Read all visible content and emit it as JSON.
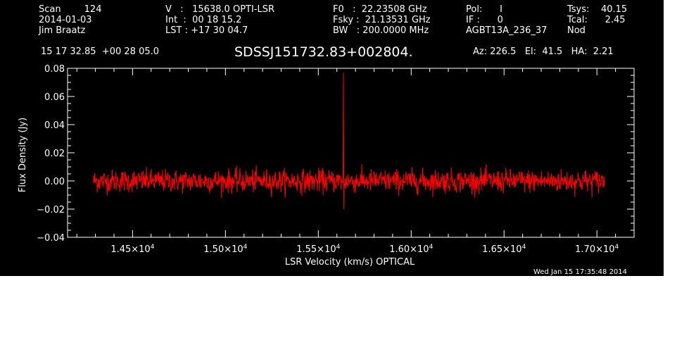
{
  "header": {
    "col1": {
      "scan": "Scan        124",
      "date": "2014-01-03",
      "observer": "Jim Braatz",
      "coords": "15 17 32.85  +00 28 05.0"
    },
    "col2": {
      "velocity": "V   :   15638.0 OPTI-LSR",
      "int": "Int  :  00 18 15.2",
      "lst": "LST : +17 30 04.7"
    },
    "col3": {
      "f0": "F0   :  22.23508 GHz",
      "fsky": "Fsky :  21.13531 GHz",
      "bw": "BW   : 200.0000 MHz"
    },
    "col4": {
      "pol": "Pol:      I",
      "if": "IF :      0",
      "project": "AGBT13A_236_37"
    },
    "col5": {
      "tsys": "Tsys:    40.15",
      "tcal": "Tcal:      2.45",
      "mode": "Nod"
    },
    "source": "SDSSJ151732.83+002804.",
    "pointing": "Az: 226.5   El:  41.5   HA:  2.21"
  },
  "footer": {
    "timestamp": "Wed Jan 15 17:35:48 2014"
  },
  "colors": {
    "background": "#000000",
    "foreground": "#ffffff",
    "trace": "#ff0000"
  },
  "chart_data": {
    "type": "line",
    "xlabel": "LSR Velocity (km/s) OPTICAL",
    "ylabel": "Flux Density (Jy)",
    "xlim": [
      14150,
      17200
    ],
    "ylim": [
      -0.04,
      0.08
    ],
    "xticks": [
      {
        "value": 14500,
        "mant": "1.45",
        "exp": "4"
      },
      {
        "value": 15000,
        "mant": "1.50",
        "exp": "4"
      },
      {
        "value": 15500,
        "mant": "1.55",
        "exp": "4"
      },
      {
        "value": 16000,
        "mant": "1.60",
        "exp": "4"
      },
      {
        "value": 16500,
        "mant": "1.65",
        "exp": "4"
      },
      {
        "value": 17000,
        "mant": "1.70",
        "exp": "4"
      }
    ],
    "yticks": [
      {
        "value": 0.08,
        "label": "0.08"
      },
      {
        "value": 0.06,
        "label": "0.06"
      },
      {
        "value": 0.04,
        "label": "0.04"
      },
      {
        "value": 0.02,
        "label": "0.02"
      },
      {
        "value": 0.0,
        "label": "0.00"
      },
      {
        "value": -0.02,
        "label": "−0.02"
      },
      {
        "value": -0.04,
        "label": "−0.04"
      }
    ],
    "series": [
      {
        "x_start": 14290,
        "x_end": 17040,
        "baseline": 0.0,
        "noise_rms": 0.004,
        "features": [
          {
            "x": 15635,
            "peak": 0.077
          },
          {
            "x": 15638,
            "peak": -0.02
          }
        ]
      }
    ],
    "grid": false
  }
}
